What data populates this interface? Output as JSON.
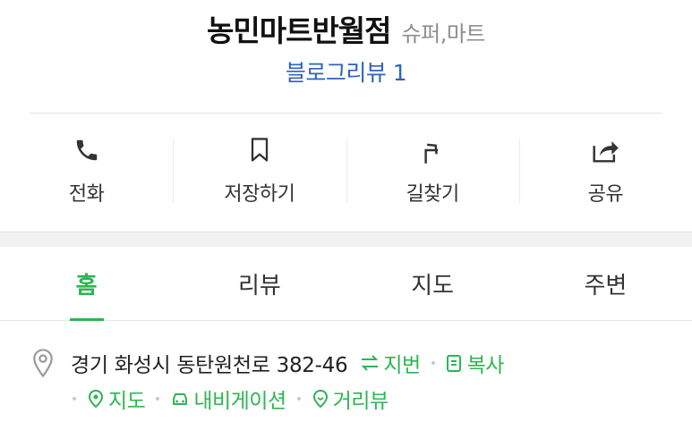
{
  "place": {
    "name": "농민마트반월점",
    "category": "슈퍼,마트",
    "review_link": "블로그리뷰 1"
  },
  "actions": {
    "call": "전화",
    "save": "저장하기",
    "directions": "길찾기",
    "share": "공유"
  },
  "tabs": {
    "home": "홈",
    "review": "리뷰",
    "map": "지도",
    "nearby": "주변",
    "active": "home"
  },
  "address": {
    "road": "경기 화성시 동탄원천로 382-46",
    "jibun": "지번",
    "copy": "복사",
    "map": "지도",
    "navigation": "내비게이션",
    "street_view": "거리뷰"
  },
  "colors": {
    "accent_green": "#2db552",
    "link_blue": "#2e63b8"
  },
  "icons": [
    "phone-icon",
    "bookmark-icon",
    "directions-icon",
    "share-icon",
    "location-pin-icon",
    "swap-icon",
    "copy-icon",
    "map-pin-icon",
    "car-icon",
    "street-view-icon"
  ]
}
